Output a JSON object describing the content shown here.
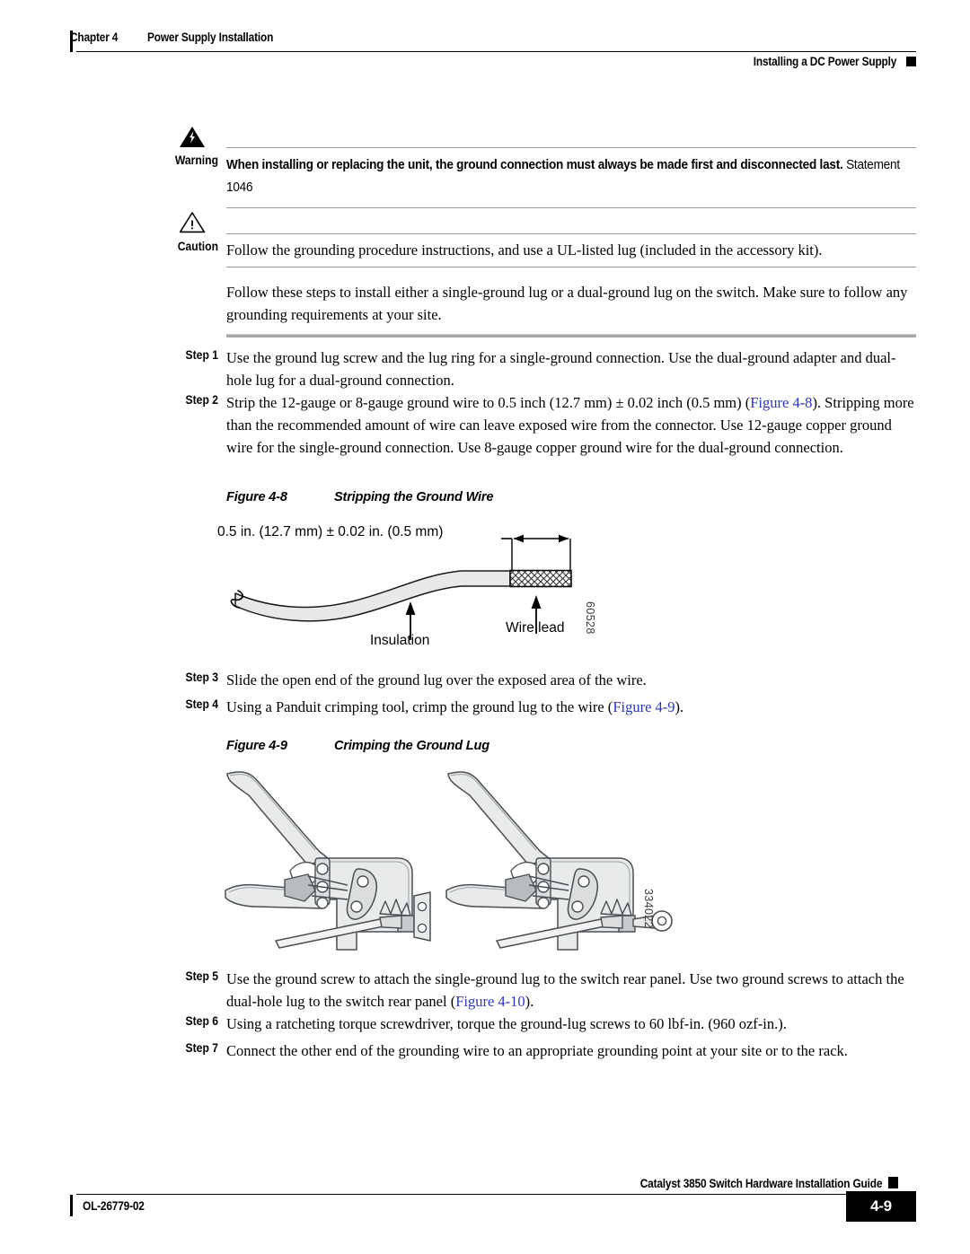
{
  "header": {
    "chapter": "Chapter 4",
    "chapter_title": "Power Supply Installation",
    "section": "Installing a DC Power Supply"
  },
  "warning": {
    "label": "Warning",
    "icon": "warning-lightning-triangle-icon",
    "text_bold": "When installing or replacing the unit, the ground connection must always be made first and disconnected last.",
    "text_normal": " Statement 1046"
  },
  "caution": {
    "label": "Caution",
    "icon": "caution-exclamation-triangle-icon",
    "text": "Follow the grounding procedure instructions, and use a UL-listed lug (included in the accessory kit)."
  },
  "intro": {
    "text": "Follow these steps to install either a single-ground lug or a dual-ground lug on the switch. Make sure to follow any grounding requirements at your site."
  },
  "steps": [
    {
      "label": "Step 1",
      "parts": [
        {
          "t": "Use the ground lug screw and the lug ring for a single-ground connection. Use the dual-ground adapter and dual-hole lug for a dual-ground connection.",
          "x": false
        }
      ]
    },
    {
      "label": "Step 2",
      "parts": [
        {
          "t": "Strip the 12-gauge or 8-gauge ground wire to 0.5 inch (12.7 mm) ± 0.02 inch (0.5 mm) (",
          "x": false
        },
        {
          "t": "Figure 4-8",
          "x": true
        },
        {
          "t": "). Stripping more than the recommended amount of wire can leave exposed wire from the connector. Use 12-gauge copper ground wire for the single-ground connection. Use 8-gauge copper ground wire for the dual-ground connection.",
          "x": false
        }
      ]
    },
    {
      "label": "Step 3",
      "parts": [
        {
          "t": "Slide the open end of the ground lug over the exposed area of the wire.",
          "x": false
        }
      ]
    },
    {
      "label": "Step 4",
      "parts": [
        {
          "t": "Using a Panduit crimping tool, crimp the ground lug to the wire (",
          "x": false
        },
        {
          "t": "Figure 4-9",
          "x": true
        },
        {
          "t": ").",
          "x": false
        }
      ]
    },
    {
      "label": "Step 5",
      "parts": [
        {
          "t": "Use the ground screw to attach the single-ground lug to the switch rear panel. Use two ground screws to attach the dual-hole lug to the switch rear panel (",
          "x": false
        },
        {
          "t": "Figure 4-10",
          "x": true
        },
        {
          "t": ").",
          "x": false
        }
      ]
    },
    {
      "label": "Step 6",
      "parts": [
        {
          "t": "Using a ratcheting torque screwdriver, torque the ground-lug screws to 60 lbf-in. (960 ozf-in.).",
          "x": false
        }
      ]
    },
    {
      "label": "Step 7",
      "parts": [
        {
          "t": "Connect the other end of the grounding wire to an appropriate grounding point at your site or to the rack.",
          "x": false
        }
      ]
    }
  ],
  "figure48": {
    "number": "Figure 4-8",
    "title": "Stripping the Ground Wire",
    "dimension_label": "0.5 in. (12.7 mm) ± 0.02 in. (0.5 mm)",
    "callout_insulation": "Insulation",
    "callout_wire_lead": "Wire lead",
    "figure_id": "60528"
  },
  "figure49": {
    "number": "Figure 4-9",
    "title": "Crimping the Ground Lug",
    "figure_id": "334022"
  },
  "footer": {
    "guide_title": "Catalyst 3850 Switch Hardware Installation Guide",
    "doc_id": "OL-26779-02",
    "page_number": "4-9"
  },
  "colors": {
    "xref_link": "#2b36c4",
    "rule_gray": "#9a9a9a",
    "art_fill": "#e8e8e8",
    "art_line": "#1a1a1a"
  }
}
